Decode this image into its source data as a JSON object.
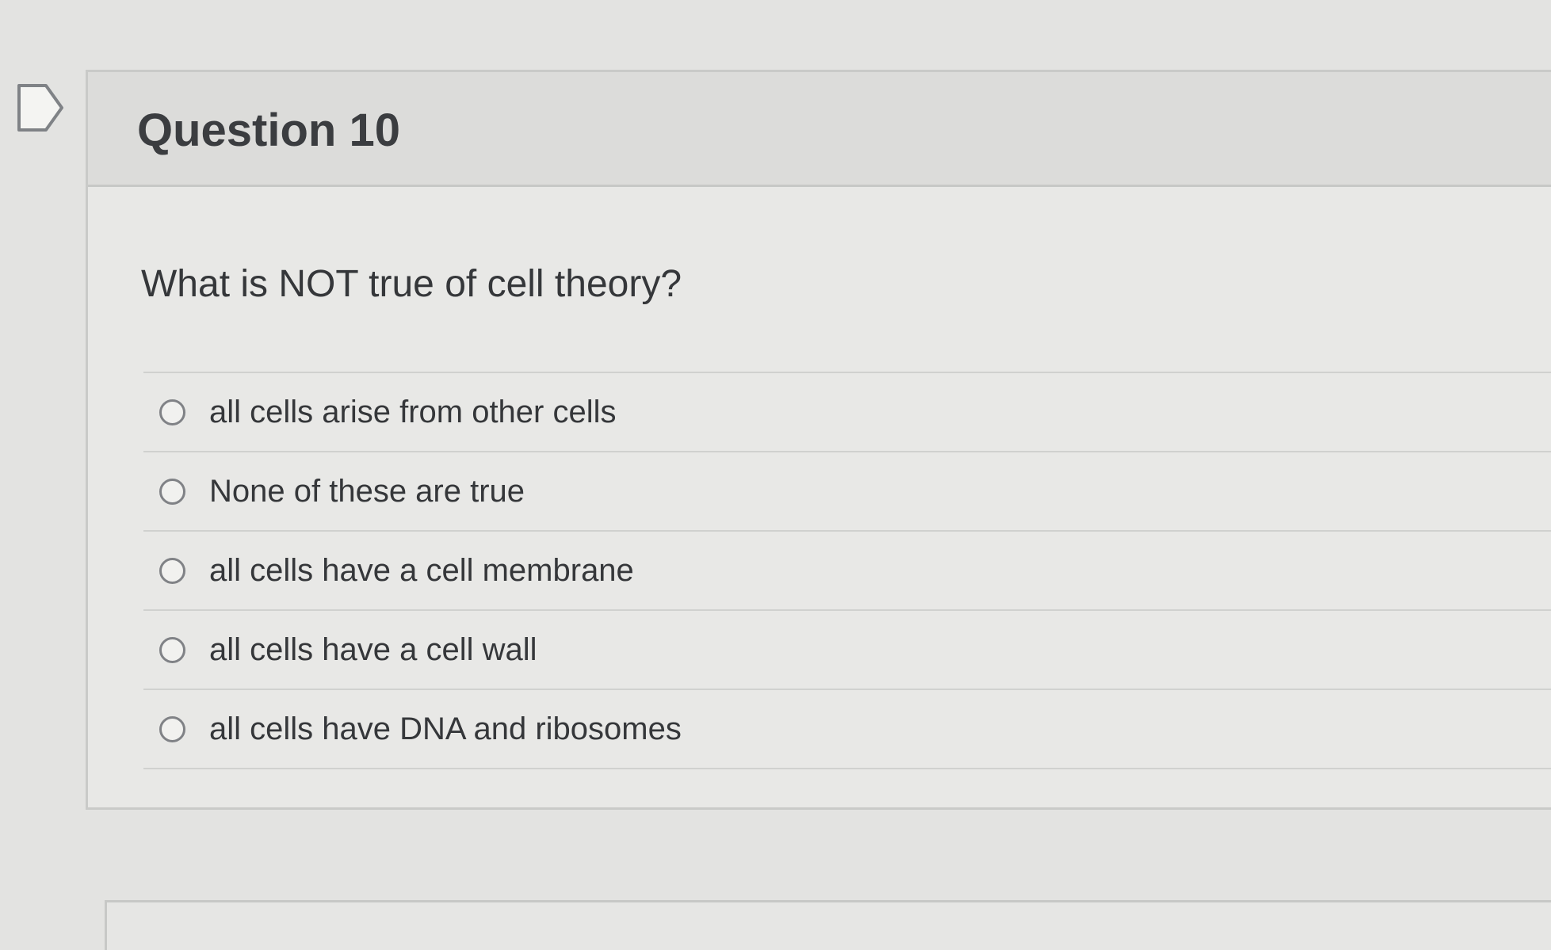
{
  "question": {
    "title": "Question 10",
    "prompt": "What is NOT true of cell theory?",
    "answers": [
      {
        "label": "all cells arise from other cells",
        "selected": false
      },
      {
        "label": "None of these are true",
        "selected": false
      },
      {
        "label": "all cells have a cell membrane",
        "selected": false
      },
      {
        "label": "all cells have a cell wall",
        "selected": false
      },
      {
        "label": "all cells have DNA and ribosomes",
        "selected": false
      }
    ]
  },
  "icons": {
    "bookmark": "flag-icon"
  },
  "colors": {
    "background": "#e3e3e1",
    "text": "#35373a",
    "radio_border": "#808286",
    "divider": "#d0d1cf"
  }
}
